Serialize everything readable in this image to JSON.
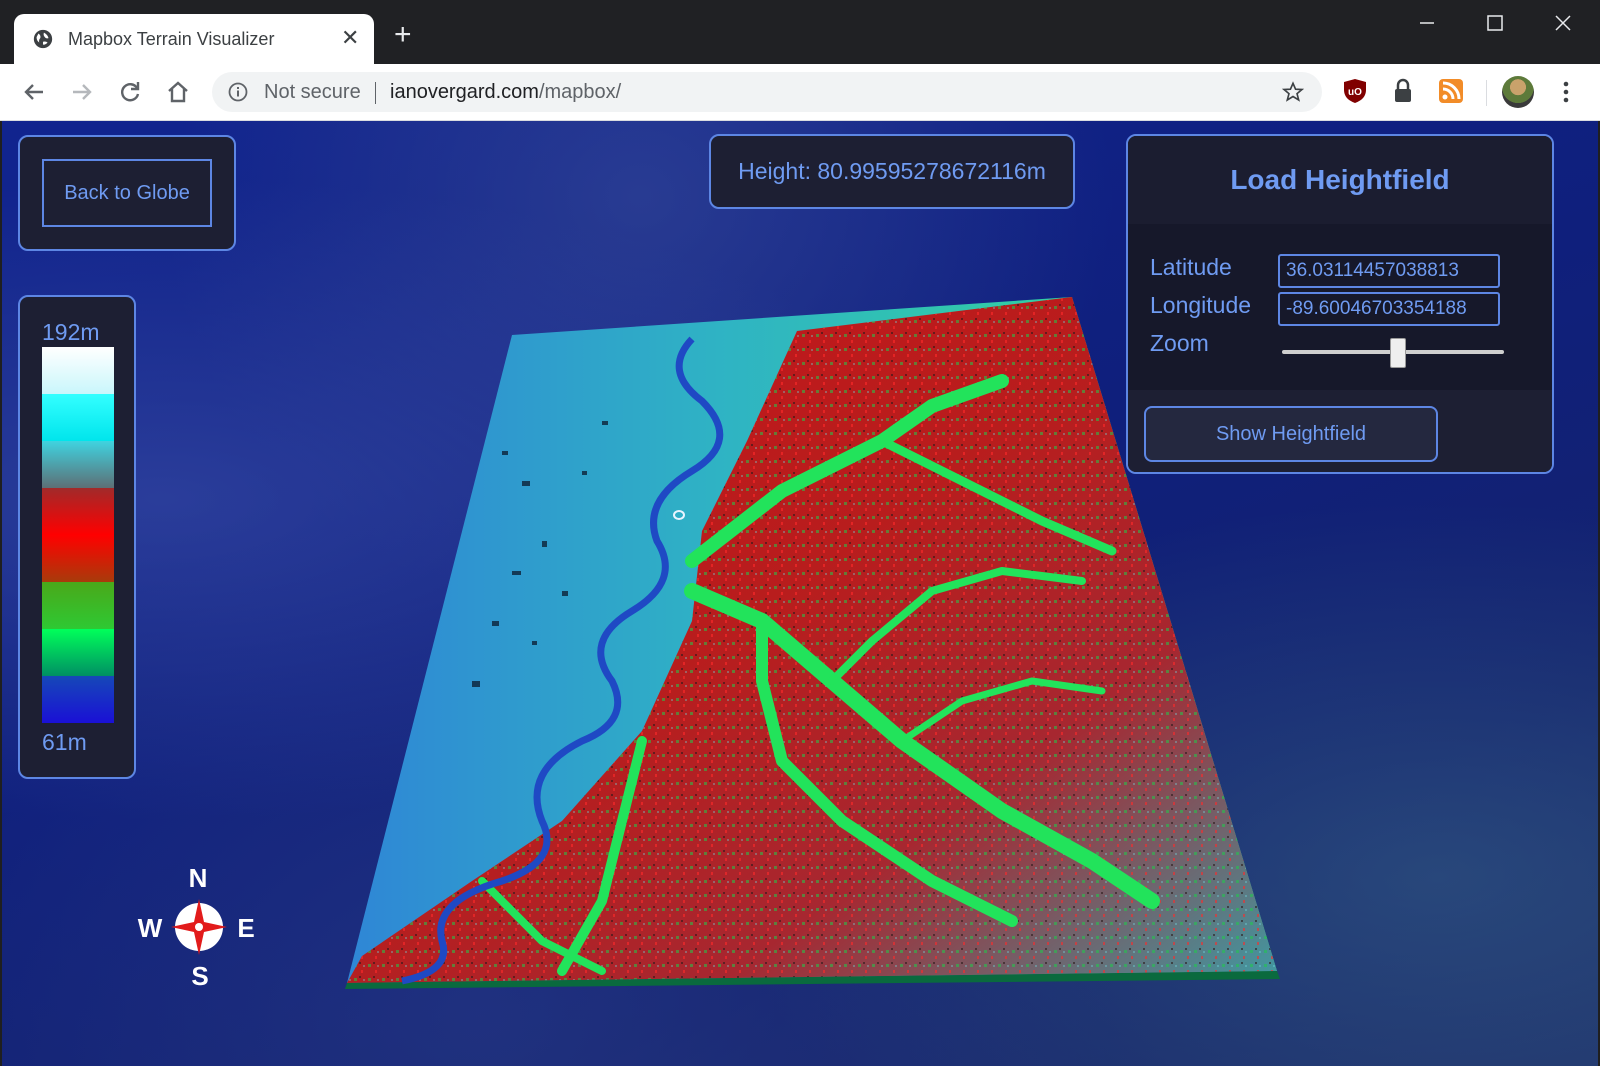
{
  "browser": {
    "tab_title": "Mapbox Terrain Visualizer",
    "security_label": "Not secure",
    "url_host": "ianovergard.com",
    "url_path": "/mapbox/",
    "icons": [
      "globe-icon",
      "close-icon",
      "plus-icon",
      "minimize-icon",
      "maximize-icon",
      "window-close-icon",
      "back-arrow-icon",
      "forward-arrow-icon",
      "reload-icon",
      "home-icon",
      "info-icon",
      "star-icon",
      "ublock-icon",
      "lock-icon",
      "rss-icon",
      "more-vert-icon"
    ]
  },
  "app": {
    "back_button": "Back to Globe",
    "height_readout": "Height: 80.99595278672116m",
    "load_panel": {
      "title": "Load Heightfield",
      "latitude_label": "Latitude",
      "latitude_value": "36.03114457038813",
      "longitude_label": "Longitude",
      "longitude_value": "-89.60046703354188",
      "zoom_label": "Zoom",
      "zoom_level": 0.52,
      "show_button": "Show Heightfield"
    },
    "legend": {
      "max_label": "192m",
      "min_label": "61m",
      "swatches": [
        [
          "#ffffff",
          "#c9f6fb"
        ],
        [
          "#33ffff",
          "#00e5ec"
        ],
        [
          "#3fd3e0",
          "#5d6f75"
        ],
        [
          "#a12a2a",
          "#ff0000"
        ],
        [
          "#ff0000",
          "#a83b0b"
        ],
        [
          "#4aa81a",
          "#2ec933"
        ],
        [
          "#00ff5a",
          "#008f63"
        ],
        [
          "#1648b8",
          "#1a10d6"
        ]
      ]
    },
    "compass": {
      "north": "N",
      "south": "S",
      "east": "E",
      "west": "W"
    },
    "colors": {
      "accent": "#6f9bf2",
      "panel_bg": "#1d1f33",
      "panel_border": "#5d86e4"
    }
  }
}
